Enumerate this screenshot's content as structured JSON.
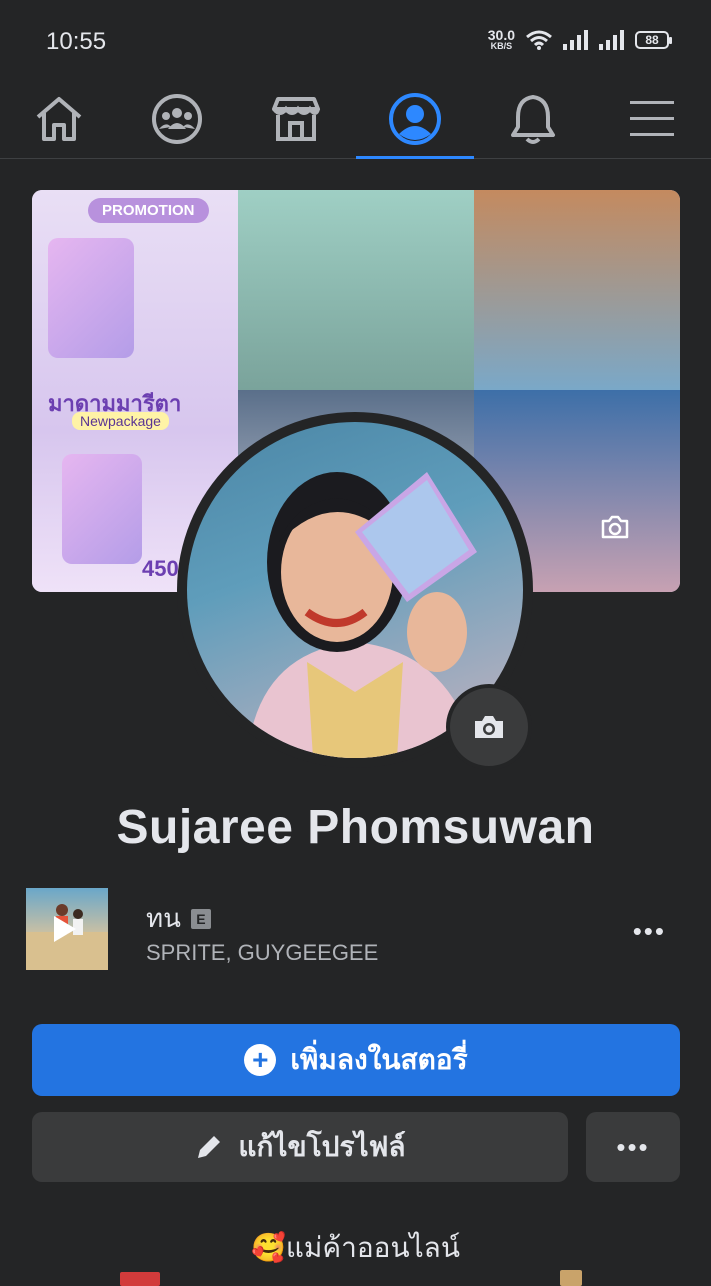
{
  "status_bar": {
    "time": "10:55",
    "net_speed_value": "30.0",
    "net_speed_unit": "KB/S",
    "battery": "88"
  },
  "nav": {
    "items": [
      {
        "icon": "home-icon"
      },
      {
        "icon": "groups-icon"
      },
      {
        "icon": "marketplace-icon"
      },
      {
        "icon": "profile-icon",
        "active": true
      },
      {
        "icon": "bell-icon"
      },
      {
        "icon": "menu-icon"
      }
    ],
    "active_color": "#2d88ff"
  },
  "cover": {
    "promo_tag": "PROMOTION",
    "promo_title": "มาดามมารีตา",
    "promo_sub": "Newpackage",
    "promo_price": "450"
  },
  "profile": {
    "name": "Sujaree Phomsuwan"
  },
  "music": {
    "title": "ทน",
    "explicit": "E",
    "artist": "SPRITE, GUYGEEGEE",
    "more": "•••"
  },
  "actions": {
    "add_story": "เพิ่มลงในสตอรี่",
    "edit_profile": "แก้ไขโปรไฟล์",
    "more": "•••",
    "primary_color": "#2374e1"
  },
  "bio": {
    "line1": "🥰แม่ค้าออนไลน์"
  }
}
